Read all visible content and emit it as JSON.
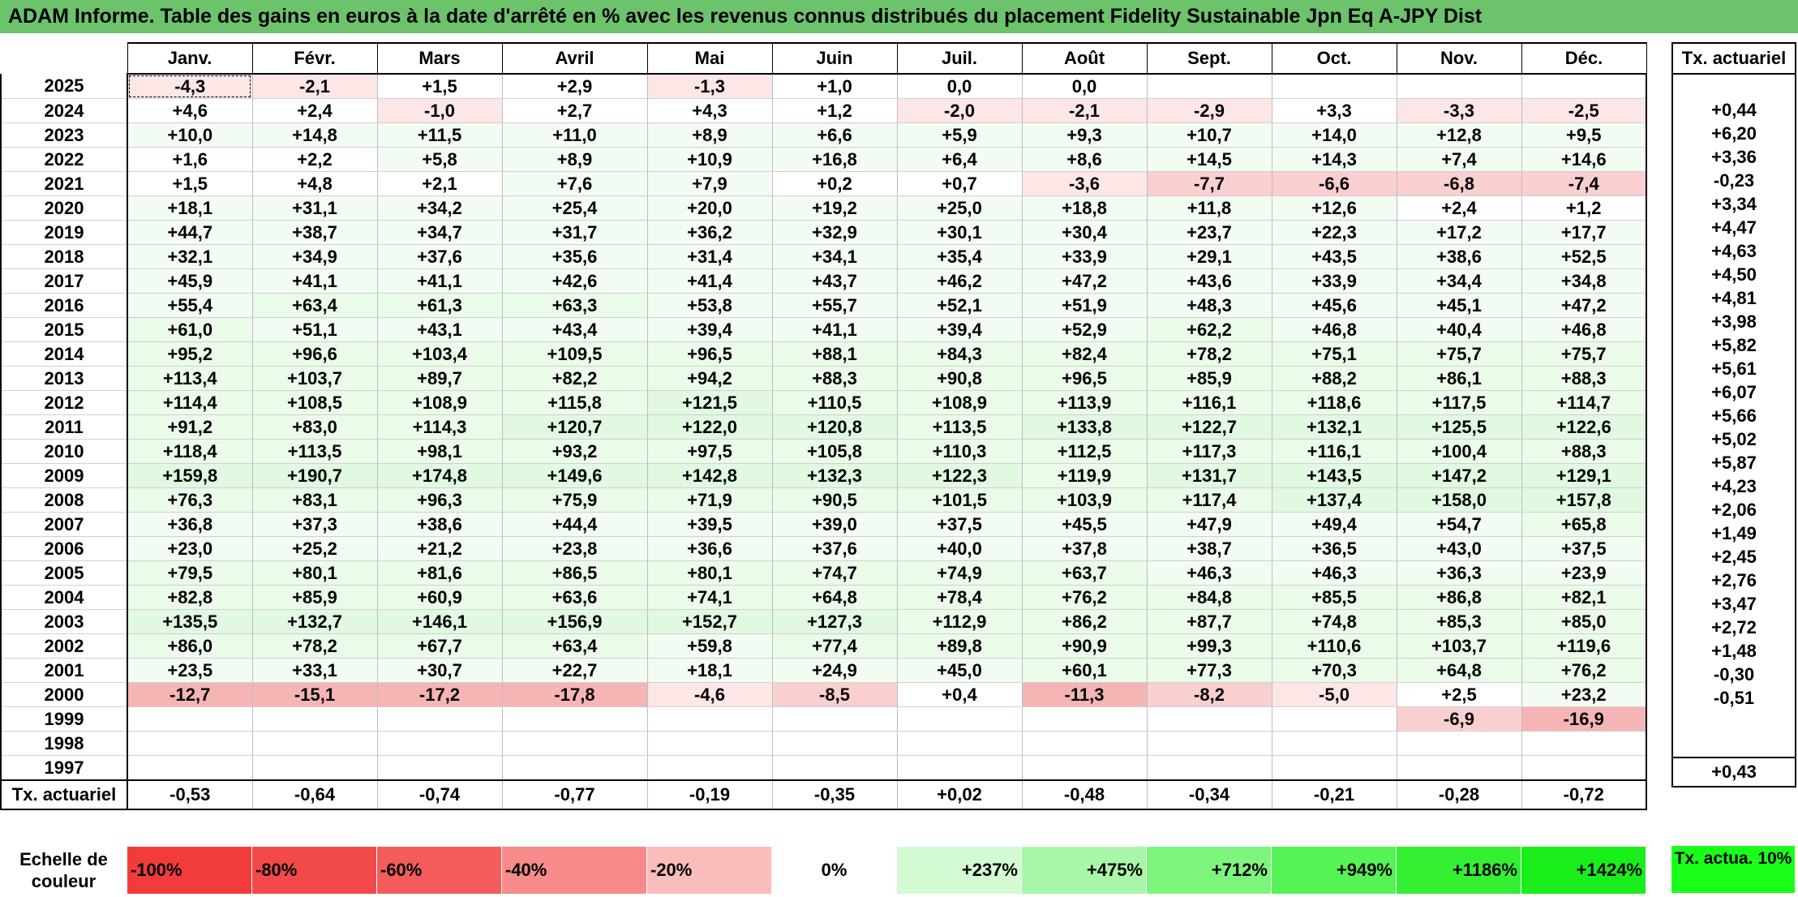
{
  "title": "ADAM Informe. Table des gains en euros à la date d'arrêté en % avec les revenus connus distribués du placement Fidelity Sustainable Jpn Eq A-JPY Dist",
  "months": [
    "Janv.",
    "Févr.",
    "Mars",
    "Avril",
    "Mai",
    "Juin",
    "Juil.",
    "Août",
    "Sept.",
    "Oct.",
    "Nov.",
    "Déc."
  ],
  "side_header": "Tx. actuariel",
  "rows": [
    {
      "year": "2025",
      "values": [
        "-4,3",
        "-2,1",
        "+1,5",
        "+2,9",
        "-1,3",
        "+1,0",
        "0,0",
        "0,0",
        "",
        "",
        "",
        ""
      ],
      "rate": ""
    },
    {
      "year": "2024",
      "values": [
        "+4,6",
        "+2,4",
        "-1,0",
        "+2,7",
        "+4,3",
        "+1,2",
        "-2,0",
        "-2,1",
        "-2,9",
        "+3,3",
        "-3,3",
        "-2,5"
      ],
      "rate": "+0,44"
    },
    {
      "year": "2023",
      "values": [
        "+10,0",
        "+14,8",
        "+11,5",
        "+11,0",
        "+8,9",
        "+6,6",
        "+5,9",
        "+9,3",
        "+10,7",
        "+14,0",
        "+12,8",
        "+9,5"
      ],
      "rate": "+6,20"
    },
    {
      "year": "2022",
      "values": [
        "+1,6",
        "+2,2",
        "+5,8",
        "+8,9",
        "+10,9",
        "+16,8",
        "+6,4",
        "+8,6",
        "+14,5",
        "+14,3",
        "+7,4",
        "+14,6"
      ],
      "rate": "+3,36"
    },
    {
      "year": "2021",
      "values": [
        "+1,5",
        "+4,8",
        "+2,1",
        "+7,6",
        "+7,9",
        "+0,2",
        "+0,7",
        "-3,6",
        "-7,7",
        "-6,6",
        "-6,8",
        "-7,4"
      ],
      "rate": "-0,23"
    },
    {
      "year": "2020",
      "values": [
        "+18,1",
        "+31,1",
        "+34,2",
        "+25,4",
        "+20,0",
        "+19,2",
        "+25,0",
        "+18,8",
        "+11,8",
        "+12,6",
        "+2,4",
        "+1,2"
      ],
      "rate": "+3,34"
    },
    {
      "year": "2019",
      "values": [
        "+44,7",
        "+38,7",
        "+34,7",
        "+31,7",
        "+36,2",
        "+32,9",
        "+30,1",
        "+30,4",
        "+23,7",
        "+22,3",
        "+17,2",
        "+17,7"
      ],
      "rate": "+4,47"
    },
    {
      "year": "2018",
      "values": [
        "+32,1",
        "+34,9",
        "+37,6",
        "+35,6",
        "+31,4",
        "+34,1",
        "+35,4",
        "+33,9",
        "+29,1",
        "+43,5",
        "+38,6",
        "+52,5"
      ],
      "rate": "+4,63"
    },
    {
      "year": "2017",
      "values": [
        "+45,9",
        "+41,1",
        "+41,1",
        "+42,6",
        "+41,4",
        "+43,7",
        "+46,2",
        "+47,2",
        "+43,6",
        "+33,9",
        "+34,4",
        "+34,8"
      ],
      "rate": "+4,50"
    },
    {
      "year": "2016",
      "values": [
        "+55,4",
        "+63,4",
        "+61,3",
        "+63,3",
        "+53,8",
        "+55,7",
        "+52,1",
        "+51,9",
        "+48,3",
        "+45,6",
        "+45,1",
        "+47,2"
      ],
      "rate": "+4,81"
    },
    {
      "year": "2015",
      "values": [
        "+61,0",
        "+51,1",
        "+43,1",
        "+43,4",
        "+39,4",
        "+41,1",
        "+39,4",
        "+52,9",
        "+62,2",
        "+46,8",
        "+40,4",
        "+46,8"
      ],
      "rate": "+3,98"
    },
    {
      "year": "2014",
      "values": [
        "+95,2",
        "+96,6",
        "+103,4",
        "+109,5",
        "+96,5",
        "+88,1",
        "+84,3",
        "+82,4",
        "+78,2",
        "+75,1",
        "+75,7",
        "+75,7"
      ],
      "rate": "+5,82"
    },
    {
      "year": "2013",
      "values": [
        "+113,4",
        "+103,7",
        "+89,7",
        "+82,2",
        "+94,2",
        "+88,3",
        "+90,8",
        "+96,5",
        "+85,9",
        "+88,2",
        "+86,1",
        "+88,3"
      ],
      "rate": "+5,61"
    },
    {
      "year": "2012",
      "values": [
        "+114,4",
        "+108,5",
        "+108,9",
        "+115,8",
        "+121,5",
        "+110,5",
        "+108,9",
        "+113,9",
        "+116,1",
        "+118,6",
        "+117,5",
        "+114,7"
      ],
      "rate": "+6,07"
    },
    {
      "year": "2011",
      "values": [
        "+91,2",
        "+83,0",
        "+114,3",
        "+120,7",
        "+122,0",
        "+120,8",
        "+113,5",
        "+133,8",
        "+122,7",
        "+132,1",
        "+125,5",
        "+122,6"
      ],
      "rate": "+5,66"
    },
    {
      "year": "2010",
      "values": [
        "+118,4",
        "+113,5",
        "+98,1",
        "+93,2",
        "+97,5",
        "+105,8",
        "+110,3",
        "+112,5",
        "+117,3",
        "+116,1",
        "+100,4",
        "+88,3"
      ],
      "rate": "+5,02"
    },
    {
      "year": "2009",
      "values": [
        "+159,8",
        "+190,7",
        "+174,8",
        "+149,6",
        "+142,8",
        "+132,3",
        "+122,3",
        "+119,9",
        "+131,7",
        "+143,5",
        "+147,2",
        "+129,1"
      ],
      "rate": "+5,87"
    },
    {
      "year": "2008",
      "values": [
        "+76,3",
        "+83,1",
        "+96,3",
        "+75,9",
        "+71,9",
        "+90,5",
        "+101,5",
        "+103,9",
        "+117,4",
        "+137,4",
        "+158,0",
        "+157,8"
      ],
      "rate": "+4,23"
    },
    {
      "year": "2007",
      "values": [
        "+36,8",
        "+37,3",
        "+38,6",
        "+44,4",
        "+39,5",
        "+39,0",
        "+37,5",
        "+45,5",
        "+47,9",
        "+49,4",
        "+54,7",
        "+65,8"
      ],
      "rate": "+2,06"
    },
    {
      "year": "2006",
      "values": [
        "+23,0",
        "+25,2",
        "+21,2",
        "+23,8",
        "+36,6",
        "+37,6",
        "+40,0",
        "+37,8",
        "+38,7",
        "+36,5",
        "+43,0",
        "+37,5"
      ],
      "rate": "+1,49"
    },
    {
      "year": "2005",
      "values": [
        "+79,5",
        "+80,1",
        "+81,6",
        "+86,5",
        "+80,1",
        "+74,7",
        "+74,9",
        "+63,7",
        "+46,3",
        "+46,3",
        "+36,3",
        "+23,9"
      ],
      "rate": "+2,45"
    },
    {
      "year": "2004",
      "values": [
        "+82,8",
        "+85,9",
        "+60,9",
        "+63,6",
        "+74,1",
        "+64,8",
        "+78,4",
        "+76,2",
        "+84,8",
        "+85,5",
        "+86,8",
        "+82,1"
      ],
      "rate": "+2,76"
    },
    {
      "year": "2003",
      "values": [
        "+135,5",
        "+132,7",
        "+146,1",
        "+156,9",
        "+152,7",
        "+127,3",
        "+112,9",
        "+86,2",
        "+87,7",
        "+74,8",
        "+85,3",
        "+85,0"
      ],
      "rate": "+3,47"
    },
    {
      "year": "2002",
      "values": [
        "+86,0",
        "+78,2",
        "+67,7",
        "+63,4",
        "+59,8",
        "+77,4",
        "+89,8",
        "+90,9",
        "+99,3",
        "+110,6",
        "+103,7",
        "+119,6"
      ],
      "rate": "+2,72"
    },
    {
      "year": "2001",
      "values": [
        "+23,5",
        "+33,1",
        "+30,7",
        "+22,7",
        "+18,1",
        "+24,9",
        "+45,0",
        "+60,1",
        "+77,3",
        "+70,3",
        "+64,8",
        "+76,2"
      ],
      "rate": "+1,48"
    },
    {
      "year": "2000",
      "values": [
        "-12,7",
        "-15,1",
        "-17,2",
        "-17,8",
        "-4,6",
        "-8,5",
        "+0,4",
        "-11,3",
        "-8,2",
        "-5,0",
        "+2,5",
        "+23,2"
      ],
      "rate": "-0,30"
    },
    {
      "year": "1999",
      "values": [
        "",
        "",
        "",
        "",
        "",
        "",
        "",
        "",
        "",
        "",
        "-6,9",
        "-16,9"
      ],
      "rate": "-0,51"
    },
    {
      "year": "1998",
      "values": [
        "",
        "",
        "",
        "",
        "",
        "",
        "",
        "",
        "",
        "",
        "",
        ""
      ],
      "rate": ""
    },
    {
      "year": "1997",
      "values": [
        "",
        "",
        "",
        "",
        "",
        "",
        "",
        "",
        "",
        "",
        "",
        ""
      ],
      "rate": ""
    }
  ],
  "summary": {
    "label": "Tx. actuariel",
    "values": [
      "-0,53",
      "-0,64",
      "-0,74",
      "-0,77",
      "-0,19",
      "-0,35",
      "+0,02",
      "-0,48",
      "-0,34",
      "-0,21",
      "-0,28",
      "-0,72"
    ],
    "total": "+0,43"
  },
  "scale": {
    "label": "Echelle de couleur",
    "items": [
      {
        "text": "-100%",
        "color": "#f23c3c"
      },
      {
        "text": "-80%",
        "color": "#f24a4a"
      },
      {
        "text": "-60%",
        "color": "#f45c5c"
      },
      {
        "text": "-40%",
        "color": "#f78a8a"
      },
      {
        "text": "-20%",
        "color": "#fbbcbc"
      },
      {
        "text": "0%",
        "color": "#ffffff"
      },
      {
        "text": "+237%",
        "color": "#d3fad3"
      },
      {
        "text": "+475%",
        "color": "#a8f7a8"
      },
      {
        "text": "+712%",
        "color": "#7df57d"
      },
      {
        "text": "+949%",
        "color": "#55f355"
      },
      {
        "text": "+1186%",
        "color": "#33f033"
      },
      {
        "text": "+1424%",
        "color": "#1aee1a"
      }
    ],
    "side_label": "Tx. actua. 10%",
    "side_color": "#1aff1a"
  },
  "colors": {
    "title_bar": "#6cc36c",
    "positive_base": "#f2fcf2",
    "negative_light": "#fde6e6",
    "negative_mid": "#f9cfcf",
    "negative_strong": "#f5b5b5"
  }
}
